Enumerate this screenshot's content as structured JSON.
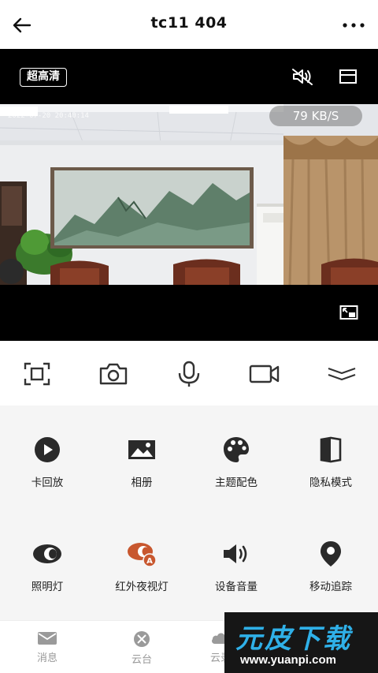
{
  "header": {
    "title": "tc11 404"
  },
  "video": {
    "quality_label": "超高清",
    "speed": "79 KB/S",
    "timestamp": "2022-07-20 20:40:14"
  },
  "functions": [
    {
      "label": "卡回放",
      "icon": "play-circle-icon"
    },
    {
      "label": "相册",
      "icon": "image-icon"
    },
    {
      "label": "主题配色",
      "icon": "palette-icon"
    },
    {
      "label": "隐私模式",
      "icon": "privacy-shield-icon"
    },
    {
      "label": "照明灯",
      "icon": "eye-light-icon"
    },
    {
      "label": "红外夜视灯",
      "icon": "night-vision-icon"
    },
    {
      "label": "设备音量",
      "icon": "volume-icon"
    },
    {
      "label": "移动追踪",
      "icon": "location-pin-icon"
    }
  ],
  "bottom_nav": [
    {
      "label": "消息",
      "icon": "message-icon"
    },
    {
      "label": "云台",
      "icon": "ptz-icon"
    },
    {
      "label": "云录",
      "icon": "cloud-record-icon"
    }
  ],
  "watermark": {
    "brand": "元皮下载",
    "url": "www.yuanpi.com"
  },
  "colors": {
    "accent_orange": "#c8572e",
    "icon_dark": "#2a2a2a",
    "watermark_blue": "#2fb0e8"
  }
}
